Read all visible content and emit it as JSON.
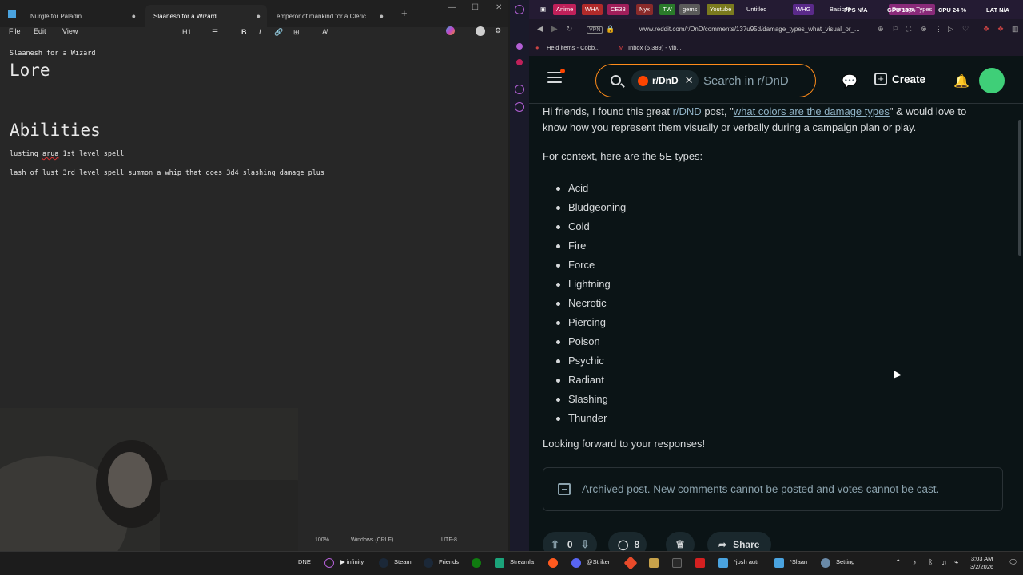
{
  "notepad": {
    "tabs": [
      {
        "label": "Nurgle for Paladin"
      },
      {
        "label": "Slaanesh for a Wizard"
      },
      {
        "label": "emperor of mankind for a Cleric"
      }
    ],
    "new_tab": "+",
    "menu": {
      "file": "File",
      "edit": "Edit",
      "view": "View"
    },
    "format": {
      "heading": "H1",
      "list": "☰",
      "bold": "B",
      "italic": "I",
      "link": "🔗",
      "table": "⊞",
      "clear": "A̸"
    },
    "content": {
      "title_line": "Slaanesh for a Wizard",
      "heading1": "Lore",
      "heading2": "Abilities",
      "line1_pre": "lusting ",
      "line1_err": "arua",
      "line1_post": " 1st level spell",
      "line2": "lash of lust 3rd level spell summon a whip that does 3d4 slashing damage plus"
    },
    "status": {
      "zoom": "100%",
      "eol": "Windows (CRLF)",
      "encoding": "UTF-8"
    }
  },
  "browser": {
    "bookmarks": [
      {
        "label": "Anime",
        "color": "#c0205a"
      },
      {
        "label": "WHA",
        "color": "#b02a2a"
      },
      {
        "label": "CE33",
        "color": "#a01e5a"
      },
      {
        "label": "Nyx",
        "color": "#8a2a2a"
      },
      {
        "label": "TW",
        "color": "#2a7a2a"
      },
      {
        "label": "gems",
        "color": "#4a4a4a"
      },
      {
        "label": "Youtube",
        "color": "#7a7a1e"
      },
      {
        "label": "Untitled",
        "color": "transparent"
      },
      {
        "label": "WHG",
        "color": "#5a2a8a"
      },
      {
        "label": "Basic R",
        "color": "transparent"
      },
      {
        "label": "Damage Types",
        "color": "#8a2a7a"
      }
    ],
    "overlay": {
      "fps": "FPS N/A",
      "gpu": "GPU 18 %",
      "cpu": "CPU 24 %",
      "lat": "LAT N/A"
    },
    "url": "www.reddit.com/r/DnD/comments/137u95d/damage_types_what_visual_or_...",
    "vpn": "VPN",
    "bookmarks2": [
      {
        "label": "Held items - Cobb..."
      },
      {
        "label": "Inbox (5,389) - vib..."
      }
    ]
  },
  "reddit": {
    "search": {
      "community": "r/DnD",
      "placeholder": "Search in r/DnD"
    },
    "create_label": "Create",
    "post": {
      "intro_a": "Hi friends, I found this great ",
      "intro_sub": "r/DND",
      "intro_b": " post, \"",
      "intro_link": "what colors are the damage types",
      "intro_c": "\" & would love to",
      "intro_line2": "know how you represent them visually or verbally during a campaign plan or play.",
      "context": "For context, here are the 5E types:",
      "damage_types": [
        "Acid",
        "Bludgeoning",
        "Cold",
        "Fire",
        "Force",
        "Lightning",
        "Necrotic",
        "Piercing",
        "Poison",
        "Psychic",
        "Radiant",
        "Slashing",
        "Thunder"
      ],
      "outro": "Looking forward to your responses!"
    },
    "archived": "Archived post. New comments cannot be posted and votes cannot be cast.",
    "actions": {
      "votes": "0",
      "comments": "8",
      "share": "Share"
    }
  },
  "taskbar": {
    "items": [
      {
        "label": "DNE"
      },
      {
        "label": "infinity"
      },
      {
        "label": "Steam"
      },
      {
        "label": "Friends"
      },
      {
        "label": "Streamla"
      },
      {
        "label": "@Striker_"
      },
      {
        "label": "*josh autı"
      },
      {
        "label": "*Slaan"
      },
      {
        "label": "Setting"
      }
    ],
    "time": "3:03 AM",
    "date": "3/2/2026"
  }
}
